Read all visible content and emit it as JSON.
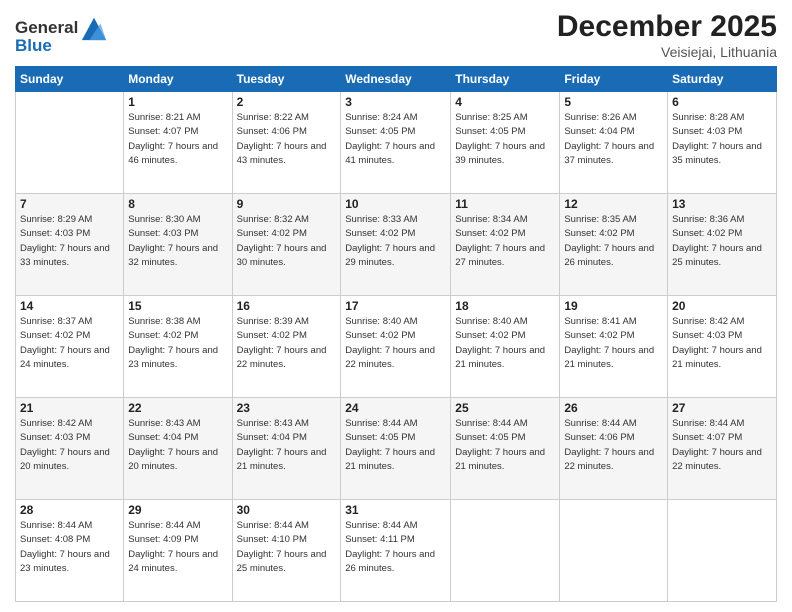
{
  "header": {
    "logo_line1": "General",
    "logo_line2": "Blue",
    "month": "December 2025",
    "location": "Veisiejai, Lithuania"
  },
  "weekdays": [
    "Sunday",
    "Monday",
    "Tuesday",
    "Wednesday",
    "Thursday",
    "Friday",
    "Saturday"
  ],
  "weeks": [
    [
      {
        "day": "",
        "sunrise": "",
        "sunset": "",
        "daylight": ""
      },
      {
        "day": "1",
        "sunrise": "Sunrise: 8:21 AM",
        "sunset": "Sunset: 4:07 PM",
        "daylight": "Daylight: 7 hours and 46 minutes."
      },
      {
        "day": "2",
        "sunrise": "Sunrise: 8:22 AM",
        "sunset": "Sunset: 4:06 PM",
        "daylight": "Daylight: 7 hours and 43 minutes."
      },
      {
        "day": "3",
        "sunrise": "Sunrise: 8:24 AM",
        "sunset": "Sunset: 4:05 PM",
        "daylight": "Daylight: 7 hours and 41 minutes."
      },
      {
        "day": "4",
        "sunrise": "Sunrise: 8:25 AM",
        "sunset": "Sunset: 4:05 PM",
        "daylight": "Daylight: 7 hours and 39 minutes."
      },
      {
        "day": "5",
        "sunrise": "Sunrise: 8:26 AM",
        "sunset": "Sunset: 4:04 PM",
        "daylight": "Daylight: 7 hours and 37 minutes."
      },
      {
        "day": "6",
        "sunrise": "Sunrise: 8:28 AM",
        "sunset": "Sunset: 4:03 PM",
        "daylight": "Daylight: 7 hours and 35 minutes."
      }
    ],
    [
      {
        "day": "7",
        "sunrise": "Sunrise: 8:29 AM",
        "sunset": "Sunset: 4:03 PM",
        "daylight": "Daylight: 7 hours and 33 minutes."
      },
      {
        "day": "8",
        "sunrise": "Sunrise: 8:30 AM",
        "sunset": "Sunset: 4:03 PM",
        "daylight": "Daylight: 7 hours and 32 minutes."
      },
      {
        "day": "9",
        "sunrise": "Sunrise: 8:32 AM",
        "sunset": "Sunset: 4:02 PM",
        "daylight": "Daylight: 7 hours and 30 minutes."
      },
      {
        "day": "10",
        "sunrise": "Sunrise: 8:33 AM",
        "sunset": "Sunset: 4:02 PM",
        "daylight": "Daylight: 7 hours and 29 minutes."
      },
      {
        "day": "11",
        "sunrise": "Sunrise: 8:34 AM",
        "sunset": "Sunset: 4:02 PM",
        "daylight": "Daylight: 7 hours and 27 minutes."
      },
      {
        "day": "12",
        "sunrise": "Sunrise: 8:35 AM",
        "sunset": "Sunset: 4:02 PM",
        "daylight": "Daylight: 7 hours and 26 minutes."
      },
      {
        "day": "13",
        "sunrise": "Sunrise: 8:36 AM",
        "sunset": "Sunset: 4:02 PM",
        "daylight": "Daylight: 7 hours and 25 minutes."
      }
    ],
    [
      {
        "day": "14",
        "sunrise": "Sunrise: 8:37 AM",
        "sunset": "Sunset: 4:02 PM",
        "daylight": "Daylight: 7 hours and 24 minutes."
      },
      {
        "day": "15",
        "sunrise": "Sunrise: 8:38 AM",
        "sunset": "Sunset: 4:02 PM",
        "daylight": "Daylight: 7 hours and 23 minutes."
      },
      {
        "day": "16",
        "sunrise": "Sunrise: 8:39 AM",
        "sunset": "Sunset: 4:02 PM",
        "daylight": "Daylight: 7 hours and 22 minutes."
      },
      {
        "day": "17",
        "sunrise": "Sunrise: 8:40 AM",
        "sunset": "Sunset: 4:02 PM",
        "daylight": "Daylight: 7 hours and 22 minutes."
      },
      {
        "day": "18",
        "sunrise": "Sunrise: 8:40 AM",
        "sunset": "Sunset: 4:02 PM",
        "daylight": "Daylight: 7 hours and 21 minutes."
      },
      {
        "day": "19",
        "sunrise": "Sunrise: 8:41 AM",
        "sunset": "Sunset: 4:02 PM",
        "daylight": "Daylight: 7 hours and 21 minutes."
      },
      {
        "day": "20",
        "sunrise": "Sunrise: 8:42 AM",
        "sunset": "Sunset: 4:03 PM",
        "daylight": "Daylight: 7 hours and 21 minutes."
      }
    ],
    [
      {
        "day": "21",
        "sunrise": "Sunrise: 8:42 AM",
        "sunset": "Sunset: 4:03 PM",
        "daylight": "Daylight: 7 hours and 20 minutes."
      },
      {
        "day": "22",
        "sunrise": "Sunrise: 8:43 AM",
        "sunset": "Sunset: 4:04 PM",
        "daylight": "Daylight: 7 hours and 20 minutes."
      },
      {
        "day": "23",
        "sunrise": "Sunrise: 8:43 AM",
        "sunset": "Sunset: 4:04 PM",
        "daylight": "Daylight: 7 hours and 21 minutes."
      },
      {
        "day": "24",
        "sunrise": "Sunrise: 8:44 AM",
        "sunset": "Sunset: 4:05 PM",
        "daylight": "Daylight: 7 hours and 21 minutes."
      },
      {
        "day": "25",
        "sunrise": "Sunrise: 8:44 AM",
        "sunset": "Sunset: 4:05 PM",
        "daylight": "Daylight: 7 hours and 21 minutes."
      },
      {
        "day": "26",
        "sunrise": "Sunrise: 8:44 AM",
        "sunset": "Sunset: 4:06 PM",
        "daylight": "Daylight: 7 hours and 22 minutes."
      },
      {
        "day": "27",
        "sunrise": "Sunrise: 8:44 AM",
        "sunset": "Sunset: 4:07 PM",
        "daylight": "Daylight: 7 hours and 22 minutes."
      }
    ],
    [
      {
        "day": "28",
        "sunrise": "Sunrise: 8:44 AM",
        "sunset": "Sunset: 4:08 PM",
        "daylight": "Daylight: 7 hours and 23 minutes."
      },
      {
        "day": "29",
        "sunrise": "Sunrise: 8:44 AM",
        "sunset": "Sunset: 4:09 PM",
        "daylight": "Daylight: 7 hours and 24 minutes."
      },
      {
        "day": "30",
        "sunrise": "Sunrise: 8:44 AM",
        "sunset": "Sunset: 4:10 PM",
        "daylight": "Daylight: 7 hours and 25 minutes."
      },
      {
        "day": "31",
        "sunrise": "Sunrise: 8:44 AM",
        "sunset": "Sunset: 4:11 PM",
        "daylight": "Daylight: 7 hours and 26 minutes."
      },
      {
        "day": "",
        "sunrise": "",
        "sunset": "",
        "daylight": ""
      },
      {
        "day": "",
        "sunrise": "",
        "sunset": "",
        "daylight": ""
      },
      {
        "day": "",
        "sunrise": "",
        "sunset": "",
        "daylight": ""
      }
    ]
  ]
}
